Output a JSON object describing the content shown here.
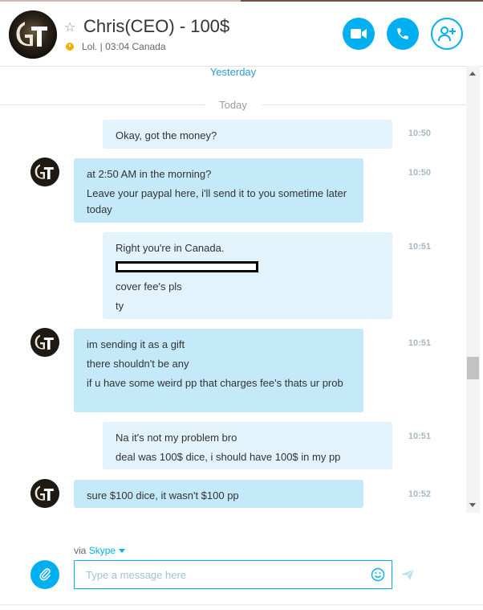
{
  "header": {
    "contact_name": "Chris(CEO) - 100$",
    "status_text": "Lol. | 03:04 Canada",
    "avatar_initials": "GT",
    "buttons": {
      "video": "video-call",
      "call": "voice-call",
      "add": "add-people"
    }
  },
  "chat": {
    "day_yesterday": "Yesterday",
    "day_today": "Today",
    "messages": [
      {
        "dir": "out",
        "time": "10:50",
        "lines": [
          "Okay, got the money?"
        ]
      },
      {
        "dir": "in",
        "time": "10:50",
        "lines": [
          "at 2:50 AM in the morning?",
          "Leave your paypal here, i'll send it to you sometime later today"
        ]
      },
      {
        "dir": "out",
        "time": "10:51",
        "lines": [
          "Right you're in Canada.",
          "cover fee's pls",
          "ty"
        ]
      },
      {
        "dir": "in",
        "time": "10:51",
        "lines": [
          "im sending it as a gift",
          "there shouldn't be any",
          "if u have some weird pp that charges fee's thats ur prob"
        ]
      },
      {
        "dir": "out",
        "time": "10:51",
        "lines": [
          "Na it's not my problem bro",
          "deal was 100$ dice, i should have 100$ in my pp"
        ]
      },
      {
        "dir": "in",
        "time": "10:52",
        "lines": [
          "sure $100 dice, it wasn't $100 pp"
        ]
      }
    ]
  },
  "composer": {
    "via_label": "via",
    "via_service": "Skype",
    "placeholder": "Type a message here"
  },
  "colors": {
    "accent": "#00aff0",
    "bubble_out": "#e3f3fb",
    "bubble_in": "#c4e9f8",
    "time": "#a9b8c3"
  }
}
